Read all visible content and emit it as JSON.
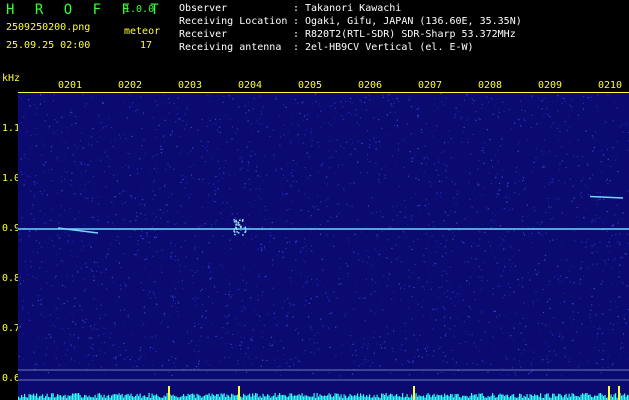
{
  "app": {
    "title": "H R O F F T",
    "version": "1.0.0"
  },
  "file": {
    "name": "2509250200.png",
    "datetime": "25.09.25 02:00"
  },
  "meteor": {
    "label": "meteor",
    "count": "17"
  },
  "info": [
    {
      "key": "Observer",
      "sep": ":",
      "value": "Takanori Kawachi"
    },
    {
      "key": "Receiving Location",
      "sep": ":",
      "value": "Ogaki, Gifu, JAPAN (136.60E, 35.35N)"
    },
    {
      "key": "Receiver",
      "sep": ":",
      "value": "R820T2(RTL-SDR) SDR-Sharp 53.372MHz"
    },
    {
      "key": "Receiving antenna",
      "sep": ":",
      "value": "2el-HB9CV Vertical (el. E-W)"
    }
  ],
  "chart_data": {
    "type": "heatmap",
    "ylabel": "kHz",
    "x_ticks": [
      "0201",
      "0202",
      "0203",
      "0204",
      "0205",
      "0206",
      "0207",
      "0208",
      "0209",
      "0210"
    ],
    "y_ticks": [
      "1.1",
      "1.0",
      "0.9",
      "0.8",
      "0.7",
      "0.6"
    ],
    "y_tick_values": [
      1.1,
      1.0,
      0.9,
      0.8,
      0.7,
      0.6
    ],
    "ylim": [
      0.58,
      1.18
    ],
    "carrier_khz": 0.9,
    "background_color": "#0a0a70",
    "signal_color": "#6fd8ff",
    "level_color": "#33ffff"
  },
  "colors": {
    "label_yellow": "#ffff33",
    "title_green": "#33ff33",
    "info_white": "#ffffff"
  }
}
